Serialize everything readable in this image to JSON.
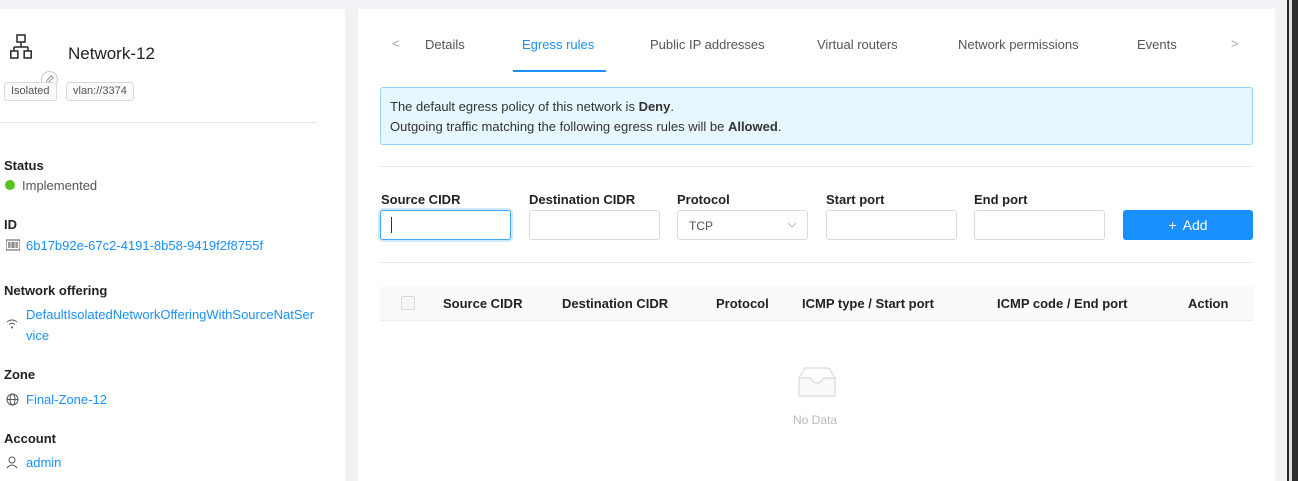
{
  "network": {
    "title": "Network-12",
    "tags": [
      "Isolated",
      "vlan://3374"
    ]
  },
  "details": {
    "status_label": "Status",
    "status_value": "Implemented",
    "id_label": "ID",
    "id_value": "6b17b92e-67c2-4191-8b58-9419f2f8755f",
    "offering_label": "Network offering",
    "offering_value_line1": "DefaultIsolatedNetworkOfferingWithSourceNatSer",
    "offering_value_line2": "vice",
    "zone_label": "Zone",
    "zone_value": "Final-Zone-12",
    "account_label": "Account",
    "account_value": "admin"
  },
  "tabs": {
    "prev_arrow": "<",
    "next_arrow": ">",
    "items": [
      "Details",
      "Egress rules",
      "Public IP addresses",
      "Virtual routers",
      "Network permissions",
      "Events"
    ],
    "active": "Egress rules"
  },
  "alert": {
    "line1_prefix": "The default egress policy of this network is ",
    "line1_bold": "Deny",
    "line1_suffix": ".",
    "line2_prefix": "Outgoing traffic matching the following egress rules will be ",
    "line2_bold": "Allowed",
    "line2_suffix": "."
  },
  "form": {
    "source_cidr_label": "Source CIDR",
    "destination_cidr_label": "Destination CIDR",
    "protocol_label": "Protocol",
    "protocol_value": "TCP",
    "start_port_label": "Start port",
    "end_port_label": "End port",
    "add_label": "Add",
    "add_icon_text": "+"
  },
  "table": {
    "columns": [
      "Source CIDR",
      "Destination CIDR",
      "Protocol",
      "ICMP type / Start port",
      "ICMP code / End port",
      "Action"
    ],
    "empty_text": "No Data",
    "rows": []
  },
  "colors": {
    "accent": "#1890ff",
    "status_ok": "#52c41a",
    "alert_bg": "#e6f7ff"
  },
  "icons": [
    "network-icon",
    "edit-icon",
    "barcode-icon",
    "wifi-icon",
    "globe-icon",
    "user-icon",
    "empty-inbox-icon"
  ]
}
